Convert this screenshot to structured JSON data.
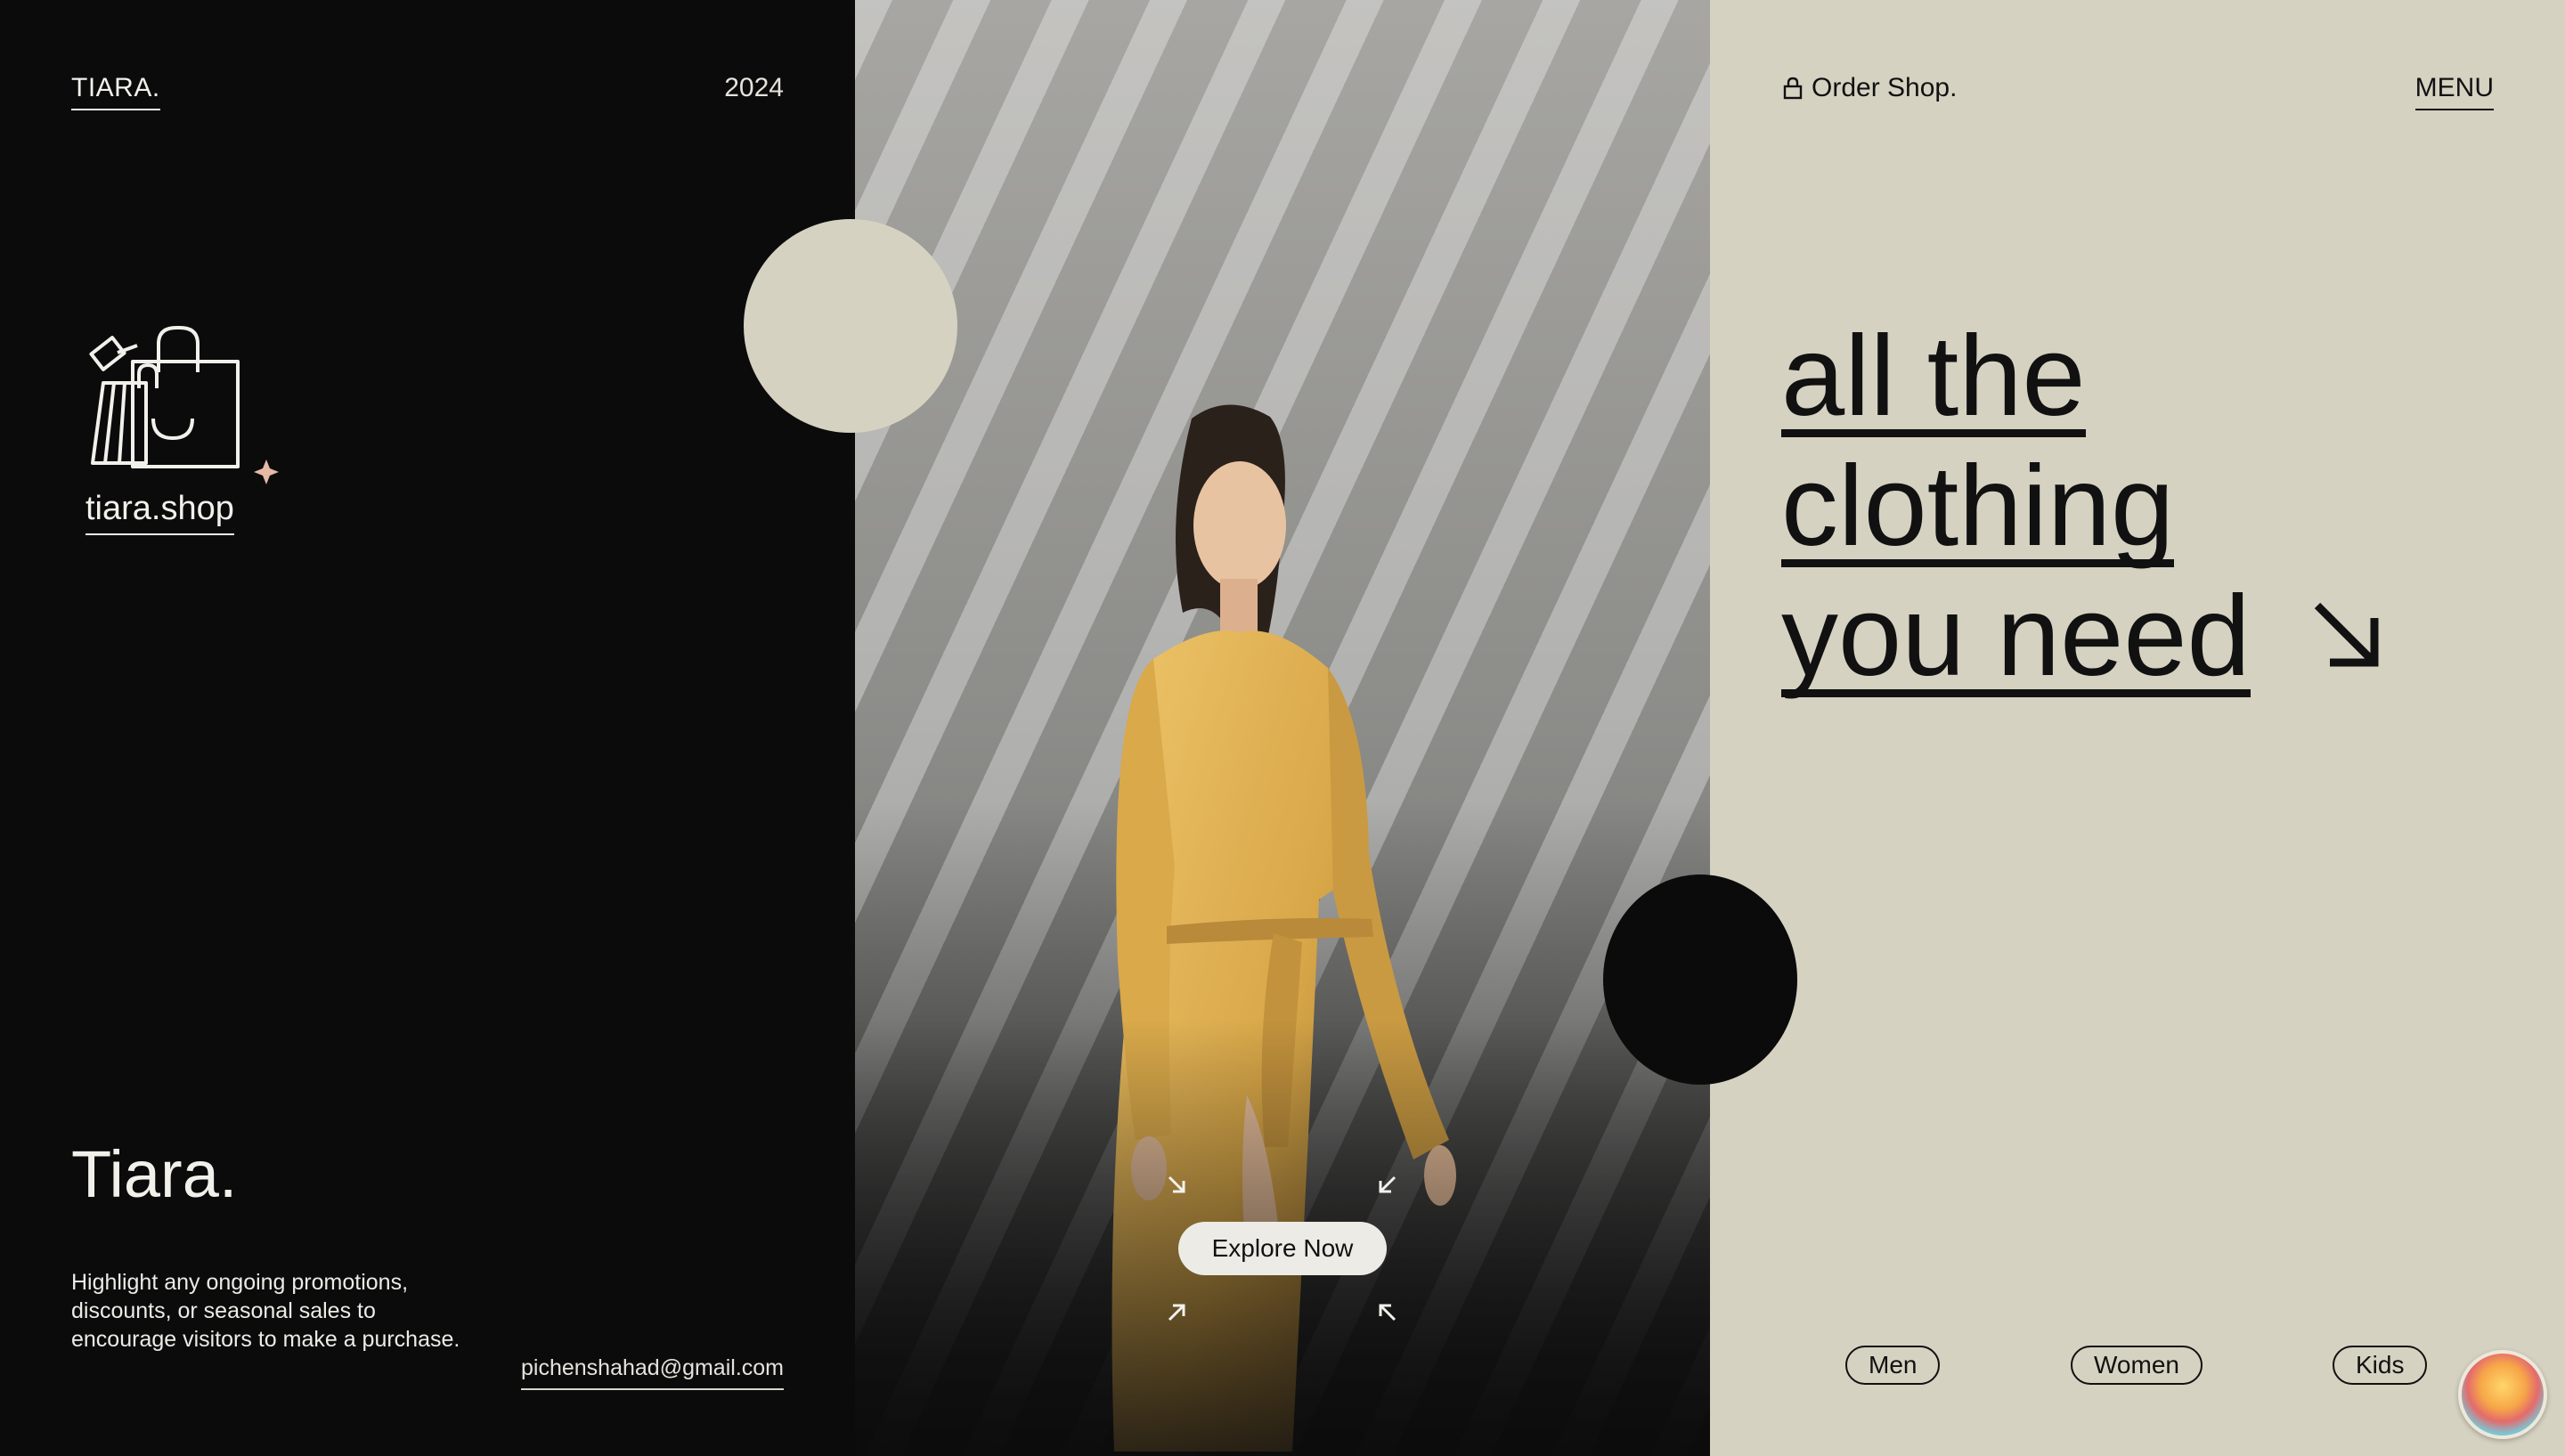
{
  "left": {
    "brand": "TIARA.",
    "year": "2024",
    "logo_text": "tiara.shop",
    "big_name": "Tiara.",
    "promo": "Highlight any ongoing promotions, discounts, or seasonal sales to encourage visitors to make a purchase.",
    "email": "pichenshahad@gmail.com"
  },
  "center": {
    "cta": "Explore Now"
  },
  "right": {
    "order_shop": "Order Shop.",
    "menu": "MENU",
    "headline": [
      "all the",
      "clothing",
      "you need"
    ],
    "categories": [
      "Men",
      "Women",
      "Kids"
    ]
  },
  "icons": {
    "logo": "shopping-bag-icon",
    "order": "lock-icon",
    "headline_arrow": "arrow-down-right-icon",
    "sparkle": "sparkle-icon"
  },
  "colors": {
    "dark": "#0b0b0c",
    "beige": "#d6d2c2",
    "dress": "#d9a94a"
  }
}
